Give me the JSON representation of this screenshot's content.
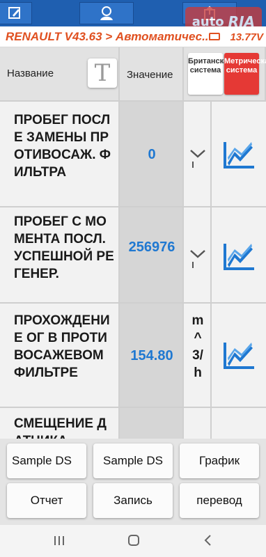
{
  "header": {
    "title": "RENAULT V43.63 > Автоматичес...",
    "voltage": "13.77V",
    "watermark_left": "auto",
    "watermark_right": "RIA"
  },
  "table": {
    "col_name": "Название",
    "col_value": "Значение",
    "unit_british": "Британская система",
    "unit_metric": "Метрическая система",
    "rows": [
      {
        "name": "ПРОБЕГ ПОСЛЕ ЗАМЕНЫ ПРОТИВОСАЖ. ФИЛЬТРА",
        "value": "0",
        "unit": "",
        "has_dropdown": true
      },
      {
        "name": "ПРОБЕГ С МОМЕНТА ПОСЛ. УСПЕШНОЙ РЕГЕНЕР.",
        "value": "256976",
        "unit": "",
        "has_dropdown": true
      },
      {
        "name": "ПРОХОЖДЕНИЕ ОГ В ПРОТИВОСАЖЕВОМ ФИЛЬТРЕ",
        "value": "154.80",
        "unit": "m^3/h",
        "has_dropdown": false
      },
      {
        "name": "СМЕЩЕНИЕ ДАТЧИКА",
        "value": "",
        "unit": "",
        "has_dropdown": false
      }
    ]
  },
  "buttons": {
    "sample_ds_1": "Sample DS",
    "sample_ds_2": "Sample DS",
    "graph": "График",
    "report": "Отчет",
    "record": "Запись",
    "translate": "перевод"
  },
  "colors": {
    "toolbar": "#1f5fb0",
    "title_text": "#e05020",
    "value_text": "#1f78d1",
    "metric_active": "#e53935"
  },
  "icons": [
    "edit-icon",
    "user-icon",
    "share-icon",
    "battery-icon",
    "graph-icon",
    "chevron-down-icon",
    "nav-recent-icon",
    "nav-home-icon",
    "nav-back-icon"
  ]
}
